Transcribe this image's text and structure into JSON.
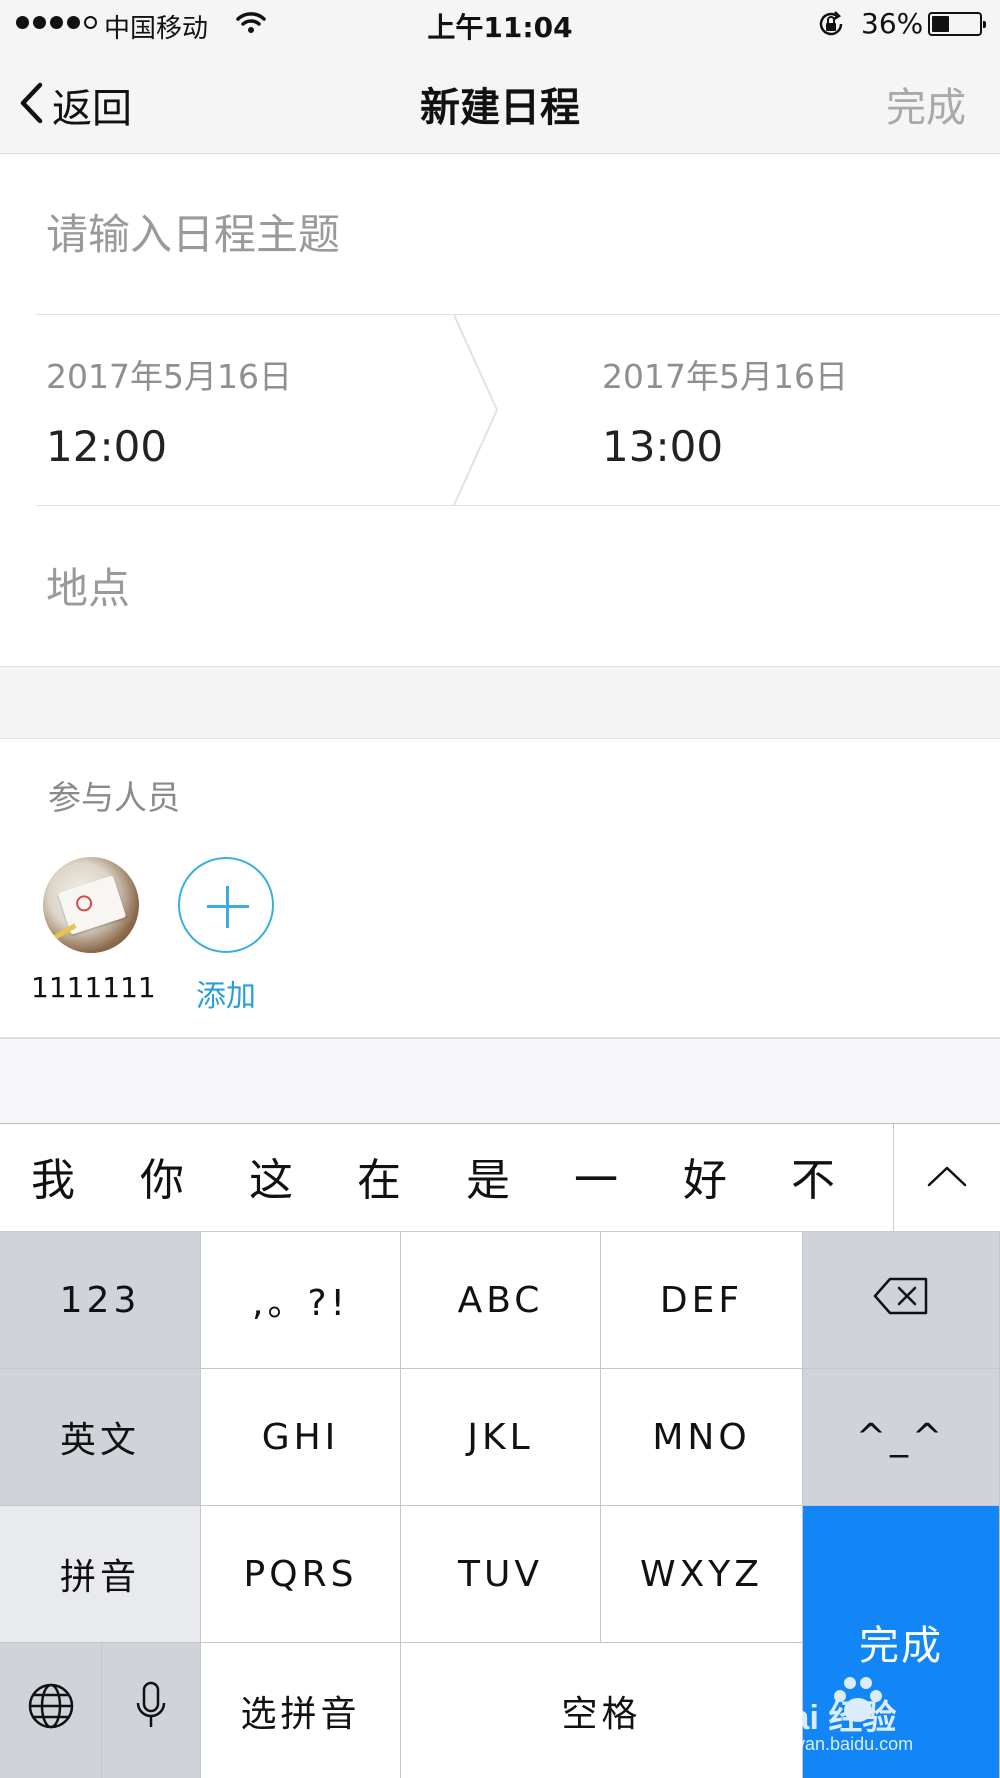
{
  "status_bar": {
    "carrier": "中国移动",
    "time": "上午11:04",
    "battery_percent": "36%",
    "battery_level": 0.36
  },
  "nav": {
    "back_label": "返回",
    "title": "新建日程",
    "done_label": "完成"
  },
  "form": {
    "subject_placeholder": "请输入日程主题",
    "start": {
      "date": "2017年5月16日",
      "time": "12:00"
    },
    "end": {
      "date": "2017年5月16日",
      "time": "13:00"
    },
    "location_placeholder": "地点"
  },
  "participants": {
    "label": "参与人员",
    "members": [
      {
        "name": "1111111"
      }
    ],
    "add_label": "添加"
  },
  "keyboard": {
    "candidates": [
      "我",
      "你",
      "这",
      "在",
      "是",
      "一",
      "好",
      "不"
    ],
    "keys": {
      "numbers": "123",
      "punct": ",。?!",
      "abc": "ABC",
      "def": "DEF",
      "english": "英文",
      "ghi": "GHI",
      "jkl": "JKL",
      "mno": "MNO",
      "emoticon": "^_^",
      "pinyin": "拼音",
      "pqrs": "PQRS",
      "tuv": "TUV",
      "wxyz": "WXYZ",
      "select_pinyin": "选拼音",
      "space": "空格",
      "done": "完成"
    },
    "accent_color": "#1285f7"
  },
  "watermark": {
    "brand": "Bai  经验",
    "url": "jingyan.baidu.com"
  }
}
